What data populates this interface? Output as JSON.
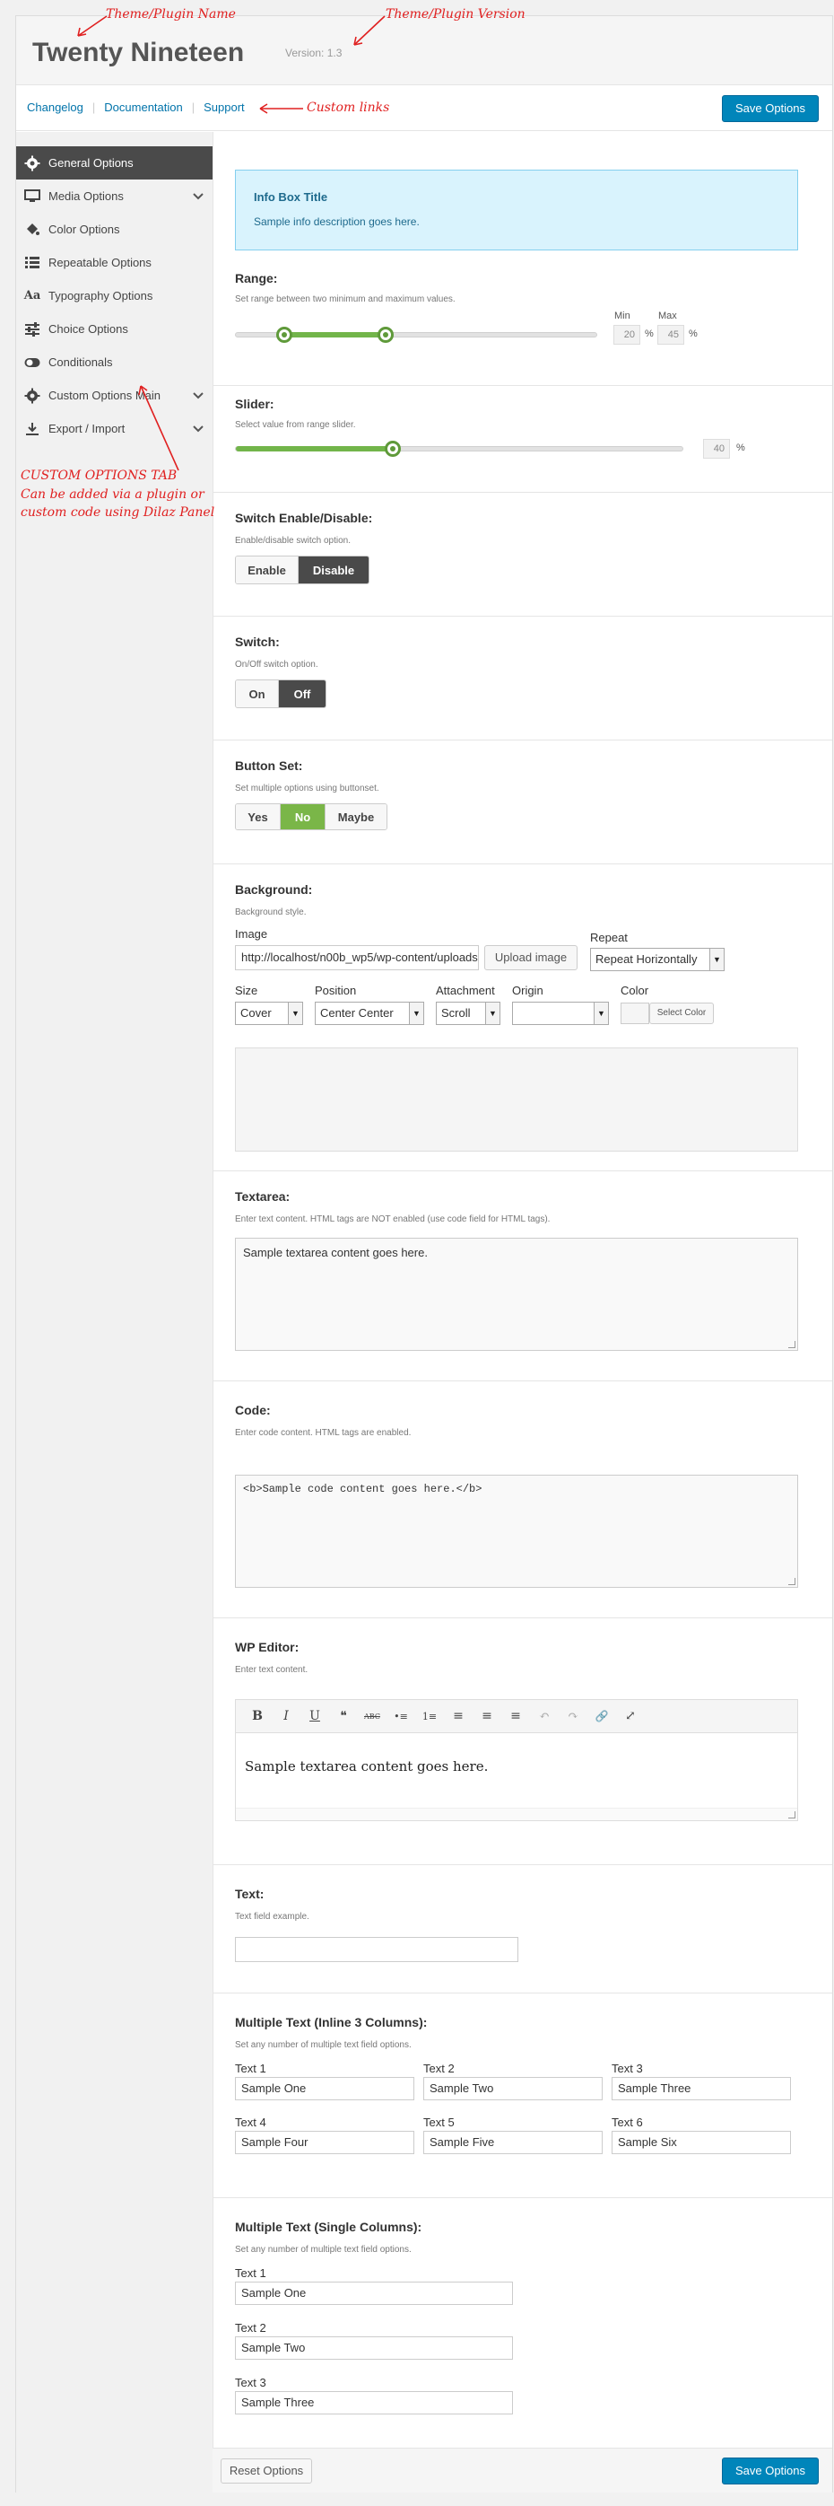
{
  "header": {
    "title": "Twenty Nineteen",
    "version": "Version: 1.3"
  },
  "toolbar": {
    "links": [
      "Changelog",
      "Documentation",
      "Support"
    ],
    "save_label": "Save Options"
  },
  "sidebar": {
    "items": [
      {
        "label": "General Options",
        "icon": "gear-icon",
        "active": true
      },
      {
        "label": "Media Options",
        "icon": "monitor-icon",
        "has_children": true
      },
      {
        "label": "Color Options",
        "icon": "paint-bucket-icon"
      },
      {
        "label": "Repeatable Options",
        "icon": "list-icon"
      },
      {
        "label": "Typography Options",
        "icon": "typography-icon"
      },
      {
        "label": "Choice Options",
        "icon": "sliders-icon"
      },
      {
        "label": "Conditionals",
        "icon": "toggle-icon"
      },
      {
        "label": "Custom Options Main",
        "icon": "gear-icon",
        "has_children": true
      },
      {
        "label": "Export / Import",
        "icon": "download-icon",
        "has_children": true
      }
    ]
  },
  "info_box": {
    "title": "Info Box Title",
    "description": "Sample info description goes here."
  },
  "range": {
    "title": "Range:",
    "description": "Set range between two minimum and maximum values.",
    "min_label": "Min",
    "max_label": "Max",
    "min_value": "20",
    "max_value": "45",
    "unit": "%"
  },
  "slider": {
    "title": "Slider:",
    "description": "Select value from range slider.",
    "value": "40",
    "unit": "%"
  },
  "switch_enable": {
    "title": "Switch Enable/Disable:",
    "description": "Enable/disable switch option.",
    "options": [
      "Enable",
      "Disable"
    ],
    "selected": "Disable"
  },
  "switch": {
    "title": "Switch:",
    "description": "On/Off switch option.",
    "options": [
      "On",
      "Off"
    ],
    "selected": "Off"
  },
  "button_set": {
    "title": "Button Set:",
    "description": "Set multiple options using buttonset.",
    "options": [
      "Yes",
      "No",
      "Maybe"
    ],
    "selected": "No"
  },
  "background": {
    "title": "Background:",
    "description": "Background style.",
    "image_label": "Image",
    "image_value": "http://localhost/n00b_wp5/wp-content/uploads",
    "upload_label": "Upload image",
    "repeat_label": "Repeat",
    "repeat_value": "Repeat Horizontally",
    "size_label": "Size",
    "size_value": "Cover",
    "position_label": "Position",
    "position_value": "Center Center",
    "attachment_label": "Attachment",
    "attachment_value": "Scroll",
    "origin_label": "Origin",
    "origin_value": "",
    "color_label": "Color",
    "select_color_label": "Select Color"
  },
  "textarea": {
    "title": "Textarea:",
    "description": "Enter text content. HTML tags are NOT enabled (use code field for HTML tags).",
    "value": "Sample textarea content goes here."
  },
  "code": {
    "title": "Code:",
    "description": "Enter code content. HTML tags are enabled.",
    "value": "<b>Sample code content goes here.</b>"
  },
  "wp_editor": {
    "title": "WP Editor:",
    "description": "Enter text content.",
    "toolbar": [
      "B",
      "I",
      "U",
      "❝",
      "ABC",
      "•≡",
      "1≡",
      "≡",
      "≡",
      "≡",
      "↶",
      "↷",
      "🔗",
      "⤢"
    ],
    "content": "Sample textarea content goes here."
  },
  "text": {
    "title": "Text:",
    "description": "Text field example.",
    "value": ""
  },
  "multi_text_inline": {
    "title": "Multiple Text (Inline 3 Columns):",
    "description": "Set any number of multiple text field options.",
    "fields": [
      {
        "label": "Text 1",
        "value": "Sample One"
      },
      {
        "label": "Text 2",
        "value": "Sample Two"
      },
      {
        "label": "Text 3",
        "value": "Sample Three"
      },
      {
        "label": "Text 4",
        "value": "Sample Four"
      },
      {
        "label": "Text 5",
        "value": "Sample Five"
      },
      {
        "label": "Text 6",
        "value": "Sample Six"
      }
    ]
  },
  "multi_text_single": {
    "title": "Multiple Text (Single Columns):",
    "description": "Set any number of multiple text field options.",
    "fields": [
      {
        "label": "Text 1",
        "value": "Sample One"
      },
      {
        "label": "Text 2",
        "value": "Sample Two"
      },
      {
        "label": "Text 3",
        "value": "Sample Three"
      }
    ]
  },
  "footer": {
    "reset_label": "Reset Options",
    "save_label": "Save Options"
  },
  "annotations": {
    "name": "Theme/Plugin Name",
    "version": "Theme/Plugin Version",
    "links": "Custom links",
    "tab_line1": "CUSTOM OPTIONS TAB",
    "tab_line2": "Can be added via a plugin or",
    "tab_line3": "custom code using Dilaz Panel"
  }
}
